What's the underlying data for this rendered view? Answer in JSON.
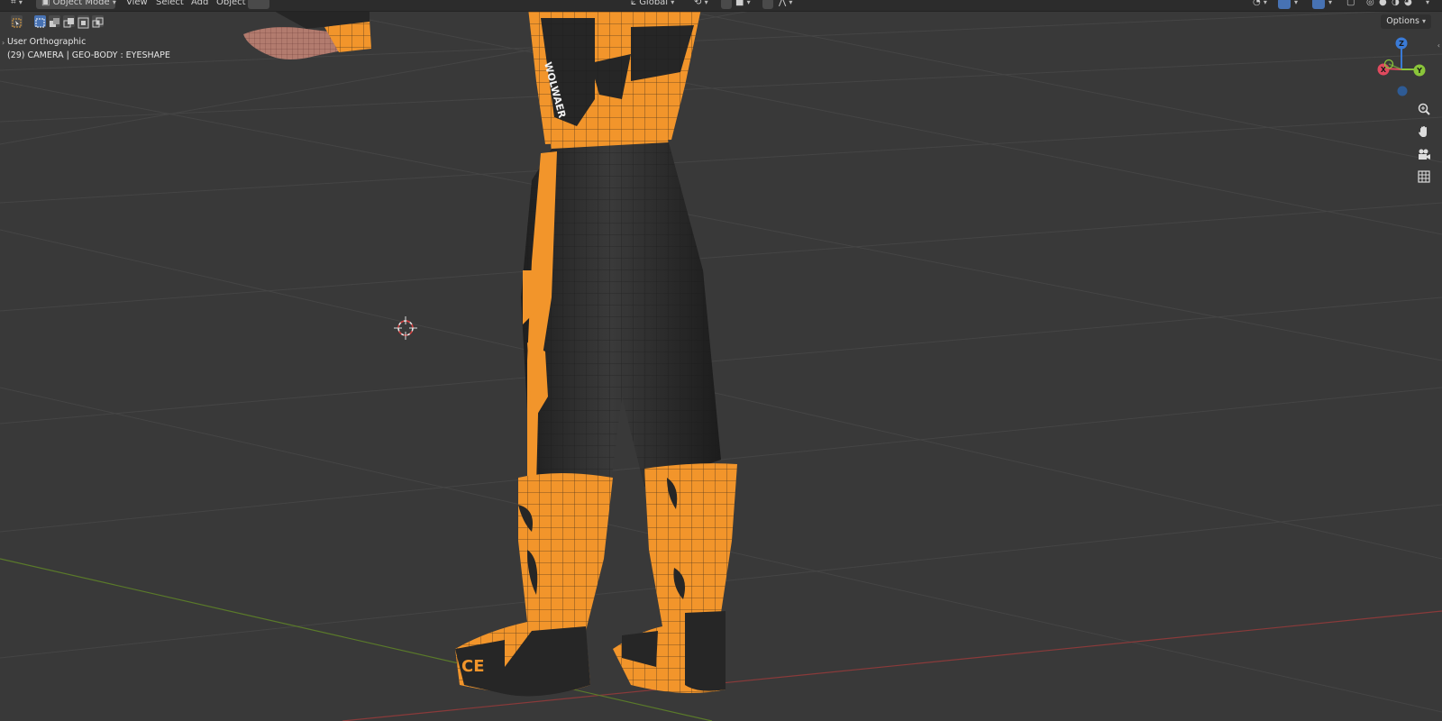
{
  "header": {
    "editor_type_icon": "editor-type-icon",
    "mode": "Object Mode",
    "menus": [
      "View",
      "Select",
      "Add",
      "Object"
    ],
    "transform_orientation": "Global",
    "options_label": "Options"
  },
  "viewport_info": {
    "view_name": "User Orthographic",
    "object_info": "(29) CAMERA | GEO-BODY : EYESHAPE"
  },
  "gizmo": {
    "x_label": "X",
    "y_label": "Y",
    "z_label": "Z",
    "colors": {
      "x": "#e04a5e",
      "y": "#8ac53a",
      "z": "#3a7ad6",
      "neg_z": "#2e5b95"
    }
  },
  "nav_icons": [
    "zoom-icon",
    "pan-hand-icon",
    "camera-view-icon",
    "orthographic-grid-icon"
  ],
  "toolbar": {
    "select_tool_icon": "cursor-select-icon",
    "selection_modes": [
      "select-new-icon",
      "select-extend-icon",
      "select-subtract-icon",
      "select-invert-icon",
      "select-intersect-icon"
    ]
  },
  "colors": {
    "background": "#393939",
    "grid": "#4a4a4a",
    "x_axis_line": "#8a3a3a",
    "y_axis_line": "#5a7a2a",
    "suit_orange": "#f2952b",
    "suit_black": "#262626",
    "accent_blue": "#4772b3"
  },
  "model": {
    "chest_text": "WOLWAER",
    "boot_text": "CE"
  }
}
